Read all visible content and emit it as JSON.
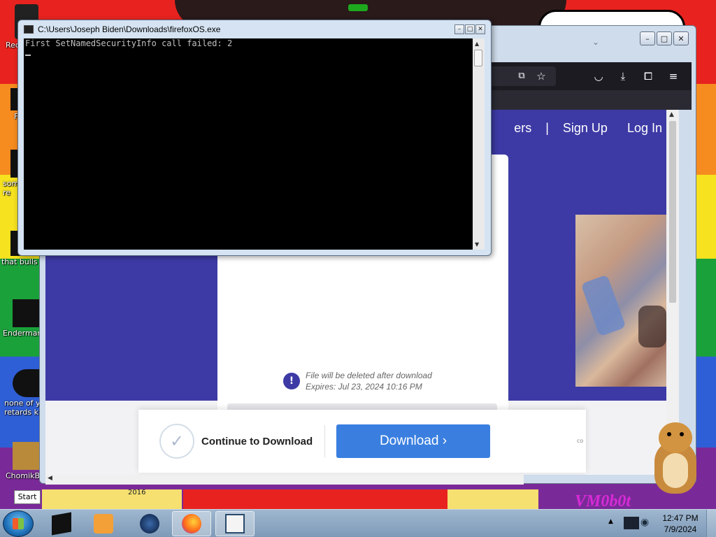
{
  "colors": {
    "stripe_red": "#e8231f",
    "stripe_orange": "#f68b1f",
    "stripe_yellow": "#f6e21f",
    "stripe_green": "#1aa13a",
    "stripe_blue": "#2f5fd6",
    "stripe_purple": "#7a2a98",
    "site_purple": "#3d3aa5",
    "download_blue": "#3a7fe0"
  },
  "desktop_icons": [
    {
      "label": "Rec",
      "icon": "recycle-bin-icon"
    },
    {
      "label": "F",
      "icon": "file-icon"
    },
    {
      "label": "som\nre",
      "icon": "file-icon"
    },
    {
      "label": "that bulls",
      "icon": "file-icon"
    },
    {
      "label": "Enderman",
      "icon": "app-icon"
    },
    {
      "label": "none of y\nretards kn",
      "icon": "app-icon"
    },
    {
      "label": "ChomikB",
      "icon": "hamster-app-icon"
    }
  ],
  "wallpaper": {
    "vm_text": "VM0b0t",
    "year_text": "2016"
  },
  "console": {
    "title": "C:\\Users\\Joseph Biden\\Downloads\\firefoxOS.exe",
    "lines": [
      "First SetNamedSecurityInfo call failed: 2"
    ]
  },
  "firefox": {
    "nav": {
      "partial": "ers",
      "sep": "|",
      "sign_up": "Sign Up",
      "log_in": "Log In"
    },
    "notice": {
      "icon": "!",
      "line1": "File will be deleted after download",
      "line2": "Expires: Jul 23, 2024 10:16 PM"
    },
    "download_bar": {
      "continue_label": "Continue to Download",
      "download_label": "Download",
      "download_arrow": "›",
      "small_text": "co"
    }
  },
  "start_tooltip": "Start",
  "taskbar": {
    "apps": [
      {
        "name": "terminal-app",
        "active": false
      },
      {
        "name": "media-player-app",
        "active": false
      },
      {
        "name": "browser-app",
        "active": false
      },
      {
        "name": "firefox-app",
        "active": true
      },
      {
        "name": "console-app",
        "active": true
      }
    ],
    "clock_time": "12:47 PM",
    "clock_date": "7/9/2024"
  }
}
